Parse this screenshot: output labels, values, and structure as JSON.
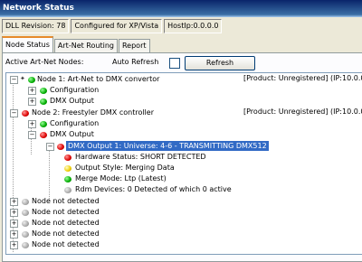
{
  "window": {
    "title": "Network Status"
  },
  "status": {
    "dll_revision": "DLL Revision: 78",
    "configured": "Configured for XP/Vista",
    "host_ip": "HostIp:0.0.0.0"
  },
  "tabs": [
    "Node Status",
    "Art-Net Routing",
    "Report"
  ],
  "toolbar": {
    "active_label": "Active Art-Net Nodes:",
    "auto_refresh_label": "Auto Refresh",
    "refresh_label": "Refresh"
  },
  "tree": {
    "node1": {
      "label": "Node 1: Art-Net to DMX convertor",
      "product": "[Product: Unregistered] (IP:10.0.0.7"
    },
    "node1_config": "Configuration",
    "node1_dmx": "DMX Output",
    "node2": {
      "label": "Node 2: Freestyler DMX controller",
      "product": "[Product: Unregistered] (IP:10.0.0.6"
    },
    "node2_config": "Configuration",
    "node2_dmx": "DMX Output",
    "dmx_out1": "DMX Output 1: Universe: 4-6 - TRANSMITTING DMX512",
    "hw_status": "Hardware Status: SHORT DETECTED",
    "output_style": "Output Style: Merging Data",
    "merge_mode": "Merge Mode: Ltp (Latest)",
    "rdm": "Rdm Devices: 0 Detected of which 0 active",
    "not_detected": [
      "Node not detected",
      "Node not detected",
      "Node not detected",
      "Node not detected",
      "Node not detected"
    ]
  },
  "colors": {
    "selection": "#316ac5",
    "title_bar": "#0a246a"
  }
}
